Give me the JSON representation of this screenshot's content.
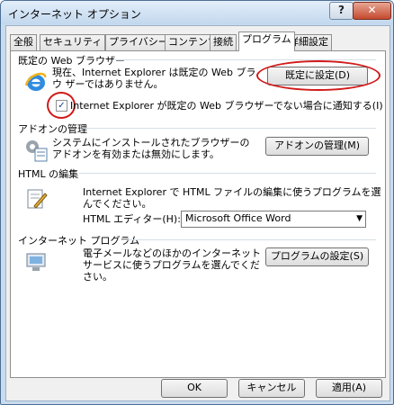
{
  "window": {
    "title": "インターネット オプション",
    "help_label": "?",
    "close_label": "✕"
  },
  "tabs": [
    "全般",
    "セキュリティ",
    "プライバシー",
    "コンテンツ",
    "接続",
    "プログラム",
    "詳細設定"
  ],
  "default_browser": {
    "section_title": "既定の Web ブラウザー",
    "description": "現在、Internet Explorer は既定の Web ブラウ ザーではありません。",
    "set_default_button": "既定に設定(D)",
    "notify_checkbox_label": "Internet Explorer が既定の Web ブラウザーでない場合に通知する(I)",
    "notify_checked": true
  },
  "addons": {
    "section_title": "アドオンの管理",
    "description": "システムにインストールされたブラウザーのアドオンを有効または無効にします。",
    "manage_button": "アドオンの管理(M)"
  },
  "html_edit": {
    "section_title": "HTML の編集",
    "description": "Internet Explorer で HTML ファイルの編集に使うプログラムを選んでください。",
    "editor_label": "HTML エディター(H):",
    "editor_value": "Microsoft Office Word"
  },
  "internet_programs": {
    "section_title": "インターネット プログラム",
    "description": "電子メールなどのほかのインターネット サービスに使うプログラムを選んでください。",
    "settings_button": "プログラムの設定(S)"
  },
  "footer": {
    "ok_label": "OK",
    "cancel_label": "キャンセル",
    "apply_label": "適用(A)"
  },
  "colors": {
    "annotation_red": "#d11a1a",
    "title_gradient_top": "#e3eefa",
    "close_red": "#c44a2f"
  }
}
